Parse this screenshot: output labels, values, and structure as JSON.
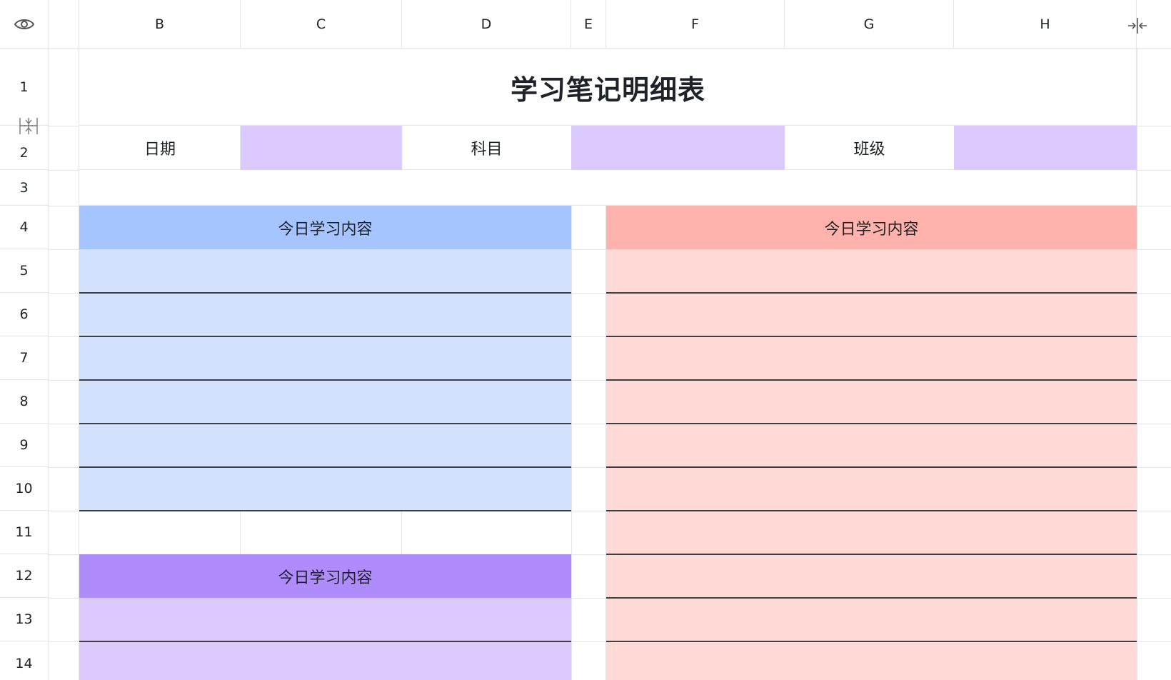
{
  "columns": [
    "B",
    "C",
    "D",
    "E",
    "F",
    "G",
    "H"
  ],
  "rows": [
    "1",
    "2",
    "3",
    "4",
    "5",
    "6",
    "7",
    "8",
    "9",
    "10",
    "11",
    "12",
    "13",
    "14"
  ],
  "title": "学习笔记明细表",
  "info_row": {
    "date_label": "日期",
    "subject_label": "科目",
    "class_label": "班级"
  },
  "sections": {
    "blue_header": "今日学习内容",
    "red_header": "今日学习内容",
    "purple_header": "今日学习内容"
  },
  "colors": {
    "blue_header": "#a6c4ff",
    "blue_fill": "#d3e2ff",
    "red_header": "#ffb3ac",
    "red_fill": "#ffdad6",
    "purple_header": "#af8bfc",
    "purple_fill": "#dccaff",
    "input_fill": "#dccaff"
  },
  "icons": {
    "top_left": "eye-icon",
    "top_right": "collapse-columns-icon",
    "row_adjust": "row-resize-icon"
  }
}
